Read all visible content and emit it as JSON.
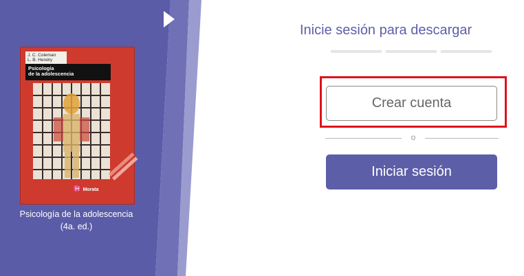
{
  "colors": {
    "brand_purple": "#5d5ea8",
    "highlight_red": "#e0101a",
    "cover_red": "#cf3a2e"
  },
  "book": {
    "cover": {
      "authors": "J. C. Coleman\nL. B. Hendry",
      "title": "Psicología\nde la adolescencia",
      "publisher": "Morata"
    },
    "caption": "Psicología de la adolescencia\n(4a. ed.)"
  },
  "login": {
    "heading": "Inicie sesión para descargar",
    "create_account_label": "Crear cuenta",
    "divider_label": "o",
    "sign_in_label": "Iniciar sesión"
  },
  "icons": {
    "play": "play-icon"
  }
}
